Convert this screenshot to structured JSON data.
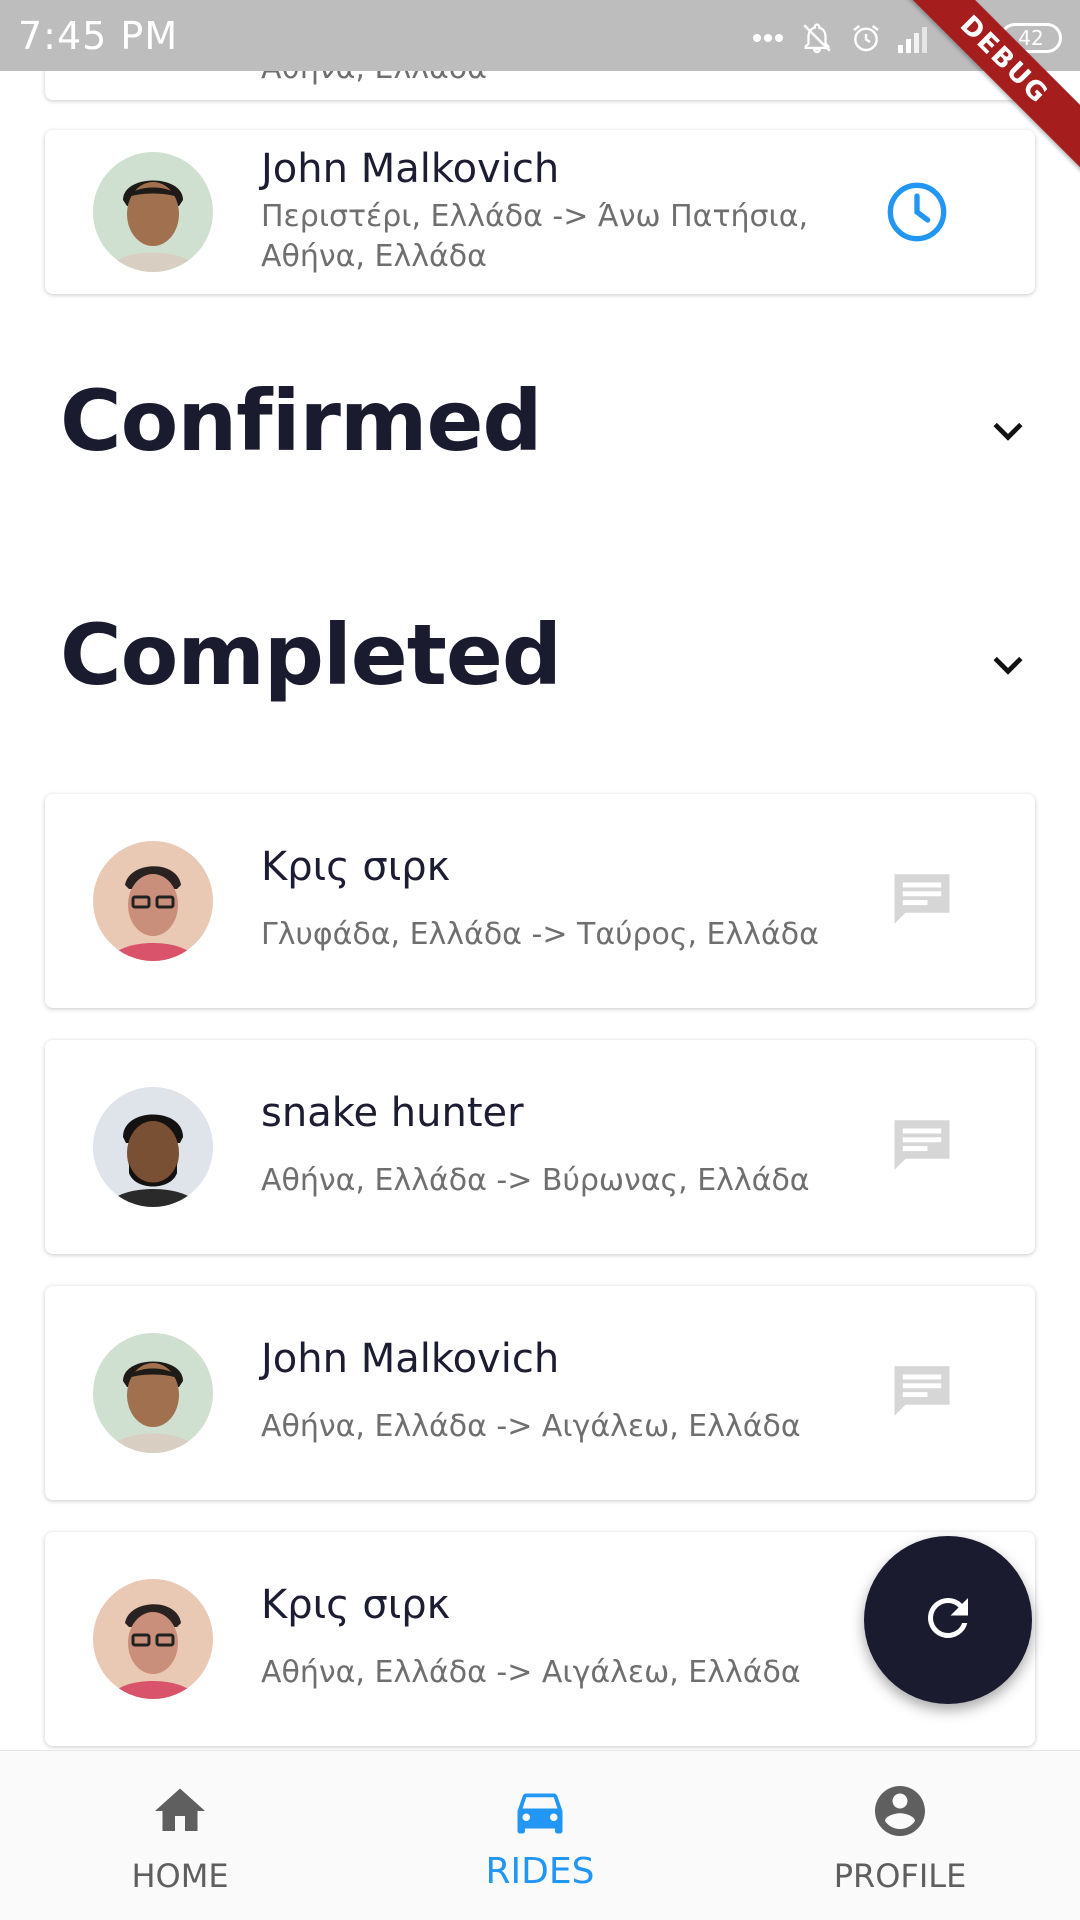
{
  "status_bar": {
    "time": "7:45 PM",
    "battery": "42",
    "debug_label": "DEBUG"
  },
  "pending_rides": [
    {
      "name": "",
      "route": "Αθήνα, Ελλάδα"
    },
    {
      "name": "John Malkovich",
      "route_line1": " Περιστέρι, Ελλάδα -> Άνω Πατήσια,",
      "route_line2": "Αθήνα, Ελλάδα",
      "action_icon": "clock-icon"
    }
  ],
  "sections": {
    "confirmed": "Confirmed",
    "completed": "Completed"
  },
  "completed_rides": [
    {
      "name": "Κρις σιρκ",
      "route": " Γλυφάδα, Ελλάδα -> Ταύρος, Ελλάδα",
      "action_icon": "message-icon"
    },
    {
      "name": "snake hunter",
      "route": " Αθήνα, Ελλάδα -> Βύρωνας, Ελλάδα",
      "action_icon": "message-icon"
    },
    {
      "name": "John Malkovich",
      "route": " Αθήνα, Ελλάδα -> Αιγάλεω, Ελλάδα",
      "action_icon": "message-icon"
    },
    {
      "name": "Κρις σιρκ",
      "route": " Αθήνα, Ελλάδα -> Αιγάλεω, Ελλάδα",
      "action_icon": "message-icon"
    }
  ],
  "fab": {
    "icon": "refresh-icon"
  },
  "bottom_nav": {
    "items": [
      {
        "label": "HOME",
        "icon": "home-icon"
      },
      {
        "label": "RIDES",
        "icon": "car-icon"
      },
      {
        "label": "PROFILE",
        "icon": "account-circle-icon"
      }
    ],
    "active_index": 1
  },
  "colors": {
    "accent": "#2196f3",
    "dark": "#1b1b30",
    "muted_icon": "#d6d6d6",
    "status_bar": "#bdbdbd",
    "debug": "#a51d1d"
  }
}
